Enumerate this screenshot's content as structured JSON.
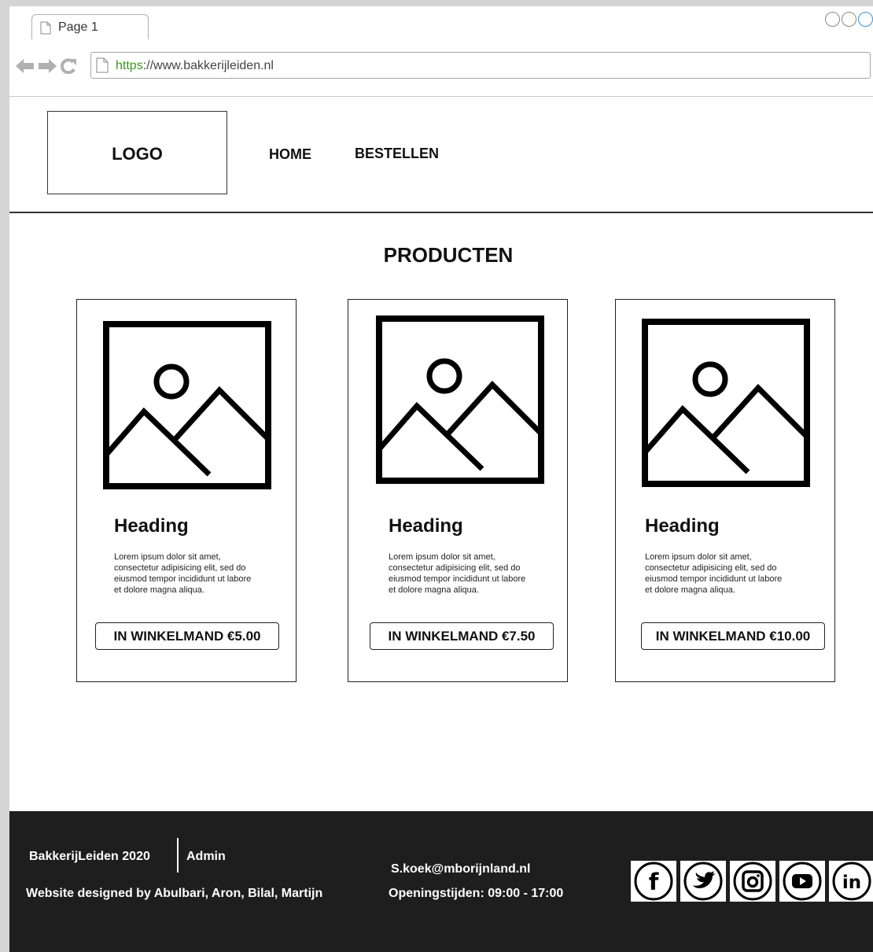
{
  "browser": {
    "tab_title": "Page 1",
    "url_scheme": "https",
    "url_rest": "://www.bakkerijleiden.nl"
  },
  "header": {
    "logo_text": "LOGO",
    "nav": [
      {
        "label": "HOME"
      },
      {
        "label": "BESTELLEN"
      }
    ]
  },
  "main": {
    "section_title": "PRODUCTEN",
    "products": [
      {
        "heading": "Heading",
        "text": "Lorem ipsum dolor sit amet, consectetur adipisicing elit, sed do eiusmod tempor incididunt ut labore et dolore magna aliqua.",
        "button": "IN WINKELMAND €5.00"
      },
      {
        "heading": "Heading",
        "text": "Lorem ipsum dolor sit amet, consectetur adipisicing elit, sed do eiusmod tempor incididunt ut labore et dolore magna aliqua.",
        "button": "IN WINKELMAND €7.50"
      },
      {
        "heading": "Heading",
        "text": "Lorem ipsum dolor sit amet, consectetur adipisicing elit, sed do eiusmod tempor incididunt ut labore et dolore magna aliqua.",
        "button": "IN WINKELMAND €10.00"
      }
    ]
  },
  "footer": {
    "copyright": "BakkerijLeiden 2020",
    "admin": "Admin",
    "designed_by": "Website designed by  Abulbari, Aron, Bilal, Martijn",
    "email": "S.koek@mborijnland.nl",
    "hours": "Openingstijden: 09:00 - 17:00",
    "socials": [
      "facebook-icon",
      "twitter-icon",
      "instagram-icon",
      "youtube-icon",
      "linkedin-icon"
    ]
  },
  "colors": {
    "url_scheme": "#3a9a1e",
    "footer_bg": "#1e1e1e",
    "window_btn_accent": "#3a8fd8"
  }
}
